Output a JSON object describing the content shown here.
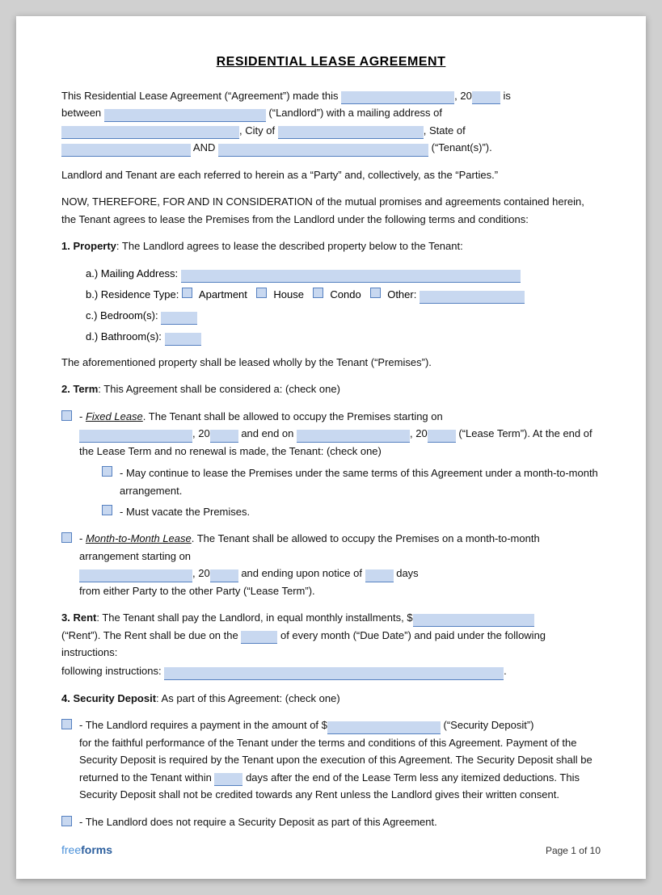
{
  "document": {
    "title": "RESIDENTIAL LEASE AGREEMENT",
    "intro_line1": "This Residential Lease Agreement (“Agreement”) made this",
    "intro_20": "20",
    "intro_is": "is",
    "intro_between": "between",
    "intro_landlord_label": "(“Landlord”) with a mailing address of",
    "intro_city_label": "City of",
    "intro_state_label": "State of",
    "intro_and": "AND",
    "intro_tenants_label": "(“Tenant(s)”).",
    "parties_text": "Landlord and Tenant are each referred to herein as a “Party” and, collectively, as the “Parties.”",
    "now_therefore": "NOW, THEREFORE, FOR AND IN CONSIDERATION of the mutual promises and agreements contained herein, the Tenant agrees to lease the Premises from the Landlord under the following terms and conditions:",
    "section1_title": "1. Property",
    "section1_text": ": The Landlord agrees to lease the described property below to the Tenant:",
    "prop_a_label": "a.)  Mailing Address:",
    "prop_b_label": "b.)  Residence Type:",
    "prop_b_apartment": "Apartment",
    "prop_b_house": "House",
    "prop_b_condo": "Condo",
    "prop_b_other": "Other:",
    "prop_c_label": "c.)  Bedroom(s):",
    "prop_d_label": "d.)  Bathroom(s):",
    "premises_text": "The aforementioned property shall be leased wholly by the Tenant (“Premises”).",
    "section2_title": "2. Term",
    "section2_text": ": This Agreement shall be considered a: (check one)",
    "fixed_lease_title": "Fixed Lease",
    "fixed_lease_text1": ". The Tenant shall be allowed to occupy the Premises starting on",
    "fixed_20_1": "20",
    "fixed_and_end": "and end on",
    "fixed_20_2": "20",
    "fixed_lease_term": "(“Lease Term”). At the end of the Lease Term and no renewal is made, the Tenant: (check one)",
    "fixed_sub1": "- May continue to lease the Premises under the same terms of this Agreement under a month-to-month arrangement.",
    "fixed_sub2": "- Must vacate the Premises.",
    "month_lease_title": "Month-to-Month Lease",
    "month_lease_text1": ". The Tenant shall be allowed to occupy the Premises on a month-to-month arrangement starting on",
    "month_20": "20",
    "month_text2": "and ending upon notice of",
    "month_days": "days",
    "month_text3": "from either Party to the other Party (“Lease Term”).",
    "section3_title": "3. Rent",
    "section3_text1": ": The Tenant shall pay the Landlord, in equal monthly installments, $",
    "rent_label": "(“Rent”). The Rent shall be due on the",
    "rent_of_every": "of every month (“Due Date”) and paid under the following instructions:",
    "section4_title": "4. Security Deposit",
    "section4_text": ": As part of this Agreement: (check one)",
    "security_text1": "- The Landlord requires a payment in the amount of $",
    "security_deposit_label": "(“Security Deposit”)",
    "security_text2": "for the faithful performance of the Tenant under the terms and conditions of this Agreement. Payment of the Security Deposit is required by the Tenant upon the execution of this Agreement. The Security Deposit shall be returned to the Tenant within",
    "security_days": "days",
    "security_text3": "after the end of the Lease Term less any itemized deductions. This Security Deposit shall not be credited towards any Rent unless the Landlord gives their written consent.",
    "security_no_deposit": "- The Landlord does not require a Security Deposit as part of this Agreement.",
    "footer_brand_free": "free",
    "footer_brand_forms": "forms",
    "footer_page": "Page 1 of 10"
  }
}
